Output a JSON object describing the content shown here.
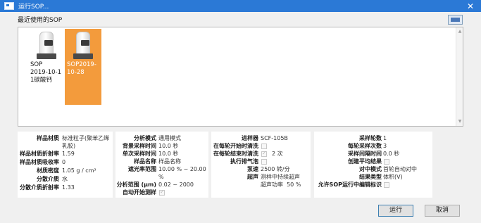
{
  "window": {
    "title": "运行SOP..."
  },
  "recent": {
    "label": "最近使用的SOP",
    "items": [
      {
        "label": "SOP\n2019-10-1\n1碳酸钙",
        "selected": false
      },
      {
        "label": "SOP2019-\n10-28",
        "selected": true
      }
    ]
  },
  "panel1": {
    "rows": [
      {
        "label": "样品材质",
        "value": "标准粒子(聚苯乙烯\n乳胶)"
      },
      {
        "label": "样品材质折射率",
        "value": "1.59"
      },
      {
        "label": "样品材质吸收率",
        "value": "0"
      },
      {
        "label": "材质密度",
        "value": "1.05 g / cm³"
      },
      {
        "label": "分散介质",
        "value": "水"
      },
      {
        "label": "分散介质折射率",
        "value": "1.33"
      }
    ]
  },
  "panel2": {
    "rows": [
      {
        "label": "分析模式",
        "value": "通用模式"
      },
      {
        "label": "背景采样时间",
        "value": "10.0 秒"
      },
      {
        "label": "单次采样时间",
        "value": "10.0 秒"
      },
      {
        "label": "样品名称",
        "value": "样品名称"
      },
      {
        "label": "遮光率范围",
        "value": "10.00 % ~ 20.00\n%"
      },
      {
        "label": "分析范围 (µm)",
        "value": "0.02 ~ 2000"
      },
      {
        "label": "自动开始测样",
        "checked": true
      }
    ]
  },
  "panel3": {
    "rows": [
      {
        "label": "进样器",
        "value": "SCF-105B"
      },
      {
        "label": "在每轮开始时清洗",
        "checked": false
      },
      {
        "label": "在每轮结束时清洗",
        "checked": true,
        "value": "2 次"
      },
      {
        "label": "执行排气泡",
        "checked": false
      },
      {
        "label": "泵速",
        "value": "2500 转/分"
      },
      {
        "label": "超声",
        "value": "测样中持续超声\n超声功率  50 %"
      }
    ]
  },
  "panel4": {
    "rows": [
      {
        "label": "采样轮数",
        "value": "1"
      },
      {
        "label": "每轮采样次数",
        "value": "3"
      },
      {
        "label": "采样间隔时间",
        "value": "0.0 秒"
      },
      {
        "label": "创建平均结果",
        "checked": false
      },
      {
        "label": "对中模式",
        "value": "首轮自动对中"
      },
      {
        "label": "结果类型",
        "value": "体积(V)"
      },
      {
        "label": "允许SOP运行中编辑标识",
        "checked": false
      }
    ]
  },
  "buttons": {
    "run": "运行",
    "cancel": "取消"
  },
  "colors": {
    "titlebar": "#2b79d6",
    "selection": "#f39b3c"
  }
}
